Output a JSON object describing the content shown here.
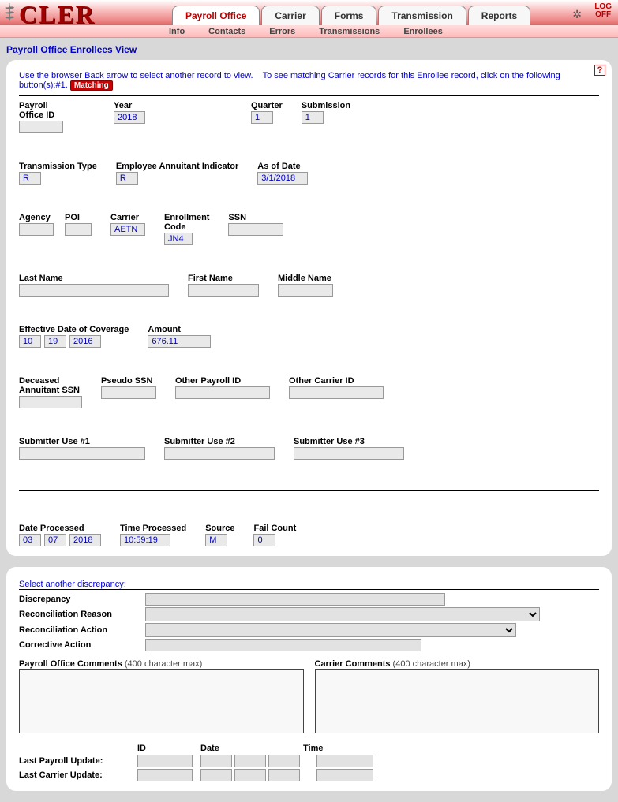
{
  "app": {
    "logo": "CLER",
    "logoff_line1": "LOG",
    "logoff_line2": "OFF"
  },
  "tabs": {
    "items": [
      "Payroll Office",
      "Carrier",
      "Forms",
      "Transmission",
      "Reports"
    ],
    "active_index": 0
  },
  "subtabs": {
    "items": [
      "Info",
      "Contacts",
      "Errors",
      "Transmissions",
      "Enrollees"
    ]
  },
  "page_title": "Payroll Office Enrollees View",
  "intro": {
    "text1": "Use the browser Back arrow to select another record to view.",
    "text2": "To see matching Carrier records for this Enrollee record, click on the following button(s):#1.",
    "matching_label": "Matching"
  },
  "fields": {
    "payroll_office_id": {
      "label": "Payroll\nOffice ID",
      "value": ""
    },
    "year": {
      "label": "Year",
      "value": "2018"
    },
    "quarter": {
      "label": "Quarter",
      "value": "1"
    },
    "submission": {
      "label": "Submission",
      "value": "1"
    },
    "transmission_type": {
      "label": "Transmission Type",
      "value": "R"
    },
    "employee_annuitant_indicator": {
      "label": "Employee Annuitant Indicator",
      "value": "R"
    },
    "as_of_date": {
      "label": "As of Date",
      "value": "3/1/2018"
    },
    "agency": {
      "label": "Agency",
      "value": ""
    },
    "poi": {
      "label": "POI",
      "value": ""
    },
    "carrier": {
      "label": "Carrier",
      "value": "AETN"
    },
    "enrollment_code": {
      "label": "Enrollment\nCode",
      "value": "JN4"
    },
    "ssn": {
      "label": "SSN",
      "value": ""
    },
    "last_name": {
      "label": "Last Name",
      "value": ""
    },
    "first_name": {
      "label": "First Name",
      "value": ""
    },
    "middle_name": {
      "label": "Middle Name",
      "value": ""
    },
    "effective_date": {
      "label": "Effective Date of Coverage",
      "month": "10",
      "day": "19",
      "year": "2016"
    },
    "amount": {
      "label": "Amount",
      "value": "676.11"
    },
    "deceased_ssn": {
      "label": "Deceased\nAnnuitant SSN",
      "value": ""
    },
    "pseudo_ssn": {
      "label": "Pseudo SSN",
      "value": ""
    },
    "other_payroll_id": {
      "label": "Other Payroll ID",
      "value": ""
    },
    "other_carrier_id": {
      "label": "Other Carrier ID",
      "value": ""
    },
    "submitter1": {
      "label": "Submitter Use #1",
      "value": ""
    },
    "submitter2": {
      "label": "Submitter Use #2",
      "value": ""
    },
    "submitter3": {
      "label": "Submitter Use #3",
      "value": ""
    },
    "date_processed": {
      "label": "Date Processed",
      "month": "03",
      "day": "07",
      "year": "2018"
    },
    "time_processed": {
      "label": "Time Processed",
      "value": "10:59:19"
    },
    "source": {
      "label": "Source",
      "value": "M"
    },
    "fail_count": {
      "label": "Fail Count",
      "value": "0"
    }
  },
  "discrepancy": {
    "title": "Select another discrepancy:",
    "rows": {
      "discrepancy": "Discrepancy",
      "reconciliation_reason": "Reconciliation Reason",
      "reconciliation_action": "Reconciliation Action",
      "corrective_action": "Corrective Action"
    },
    "payroll_comments_label": "Payroll Office Comments",
    "carrier_comments_label": "Carrier Comments",
    "char_max": "(400 character max)"
  },
  "updates": {
    "headers": {
      "id": "ID",
      "date": "Date",
      "time": "Time"
    },
    "last_payroll": "Last Payroll Update:",
    "last_carrier": "Last Carrier Update:"
  }
}
